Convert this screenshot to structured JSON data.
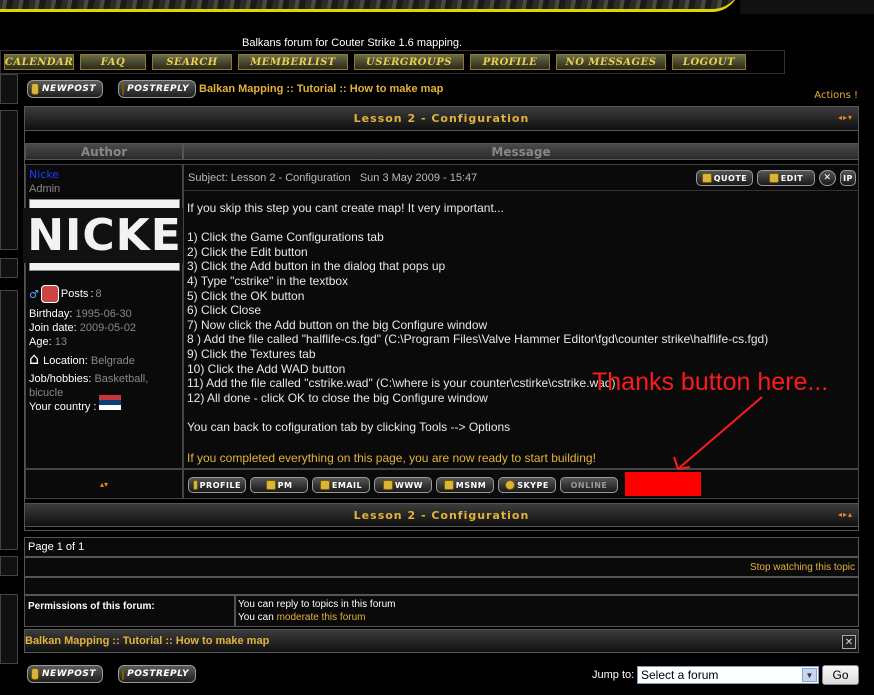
{
  "site": {
    "description": "Balkans forum for Couter Strike 1.6 mapping."
  },
  "menu": [
    "CALENDAR",
    "FAQ",
    "SEARCH",
    "MEMBERLIST",
    "USERGROUPS",
    "PROFILE",
    "NO MESSAGES",
    "LOGOUT"
  ],
  "buttons": {
    "new_post": "NEWPOST",
    "post_reply": "POSTREPLY"
  },
  "breadcrumb": {
    "items": [
      "Balkan Mapping",
      "Tutorial",
      "How to make map"
    ],
    "separator": "::"
  },
  "actions_label": "Actions !",
  "topic": {
    "title": "Lesson 2 - Configuration",
    "nav_arrows_top": "◂▸▾",
    "nav_arrows_bottom": "◂▸▴"
  },
  "columns": {
    "author": "Author",
    "message": "Message"
  },
  "author": {
    "username": "Nicke",
    "rank": "Admin",
    "avatar_text": "NICKE",
    "posts_label": "Posts",
    "posts": "8",
    "birthday_label": "Birthday",
    "birthday": "1995-06-30",
    "join_label": "Join date",
    "join_date": "2009-05-02",
    "age_label": "Age",
    "age": "13",
    "location_label": "Location",
    "location": "Belgrade",
    "hobbies_label": "Job/hobbies",
    "hobbies": "Basketball, bicucle",
    "country_label": "Your country"
  },
  "post": {
    "subject_line": "Subject: Lesson 2 - Configuration   Sun 3 May 2009 - 15:47",
    "actions": [
      "QUOTE",
      "EDIT"
    ],
    "body": "If you skip this step you cant create map! It very important...\n\n1) Click the Game Configurations tab\n2) Click the Edit button\n3) Click the Add button in the dialog that pops up\n4) Type \"cstrike\" in the textbox\n5) Click the OK button\n6) Click Close\n7) Now click the Add button on the big Configure window\n8 ) Add the file called \"halflife-cs.fgd\" (C:\\Program Files\\Valve Hammer Editor\\fgd\\counter strike\\halflife-cs.fgd)\n9) Click the Textures tab\n10) Click the Add WAD button\n11) Add the file called \"cstrike.wad\" (C:\\where is your counter\\cstirke\\cstrike.wad)\n12) All done - click OK to close the big Configure window\n\nYou can back to cofiguration tab by clicking Tools --> Options",
    "footer_note": "If you completed everything on this page, you are now ready to start building!",
    "contact_buttons": [
      "PROFILE",
      "PM",
      "EMAIL",
      "WWW",
      "MSNM",
      "SKYPE",
      "ONLINE"
    ],
    "annotation": "Thanks button here..."
  },
  "pagination": "Page 1 of 1",
  "stop_watching": "Stop watching this topic",
  "permissions": {
    "label": "Permissions of this forum:",
    "line1": "You can reply to topics in this forum",
    "line2_prefix": "You can",
    "line2_link": "moderate this forum"
  },
  "jump": {
    "label": "Jump to:",
    "selected": "Select a forum",
    "go": "Go"
  },
  "colors": {
    "accent": "#e3b23c",
    "annotation": "#ff1a1a",
    "username": "#1e3cff"
  }
}
